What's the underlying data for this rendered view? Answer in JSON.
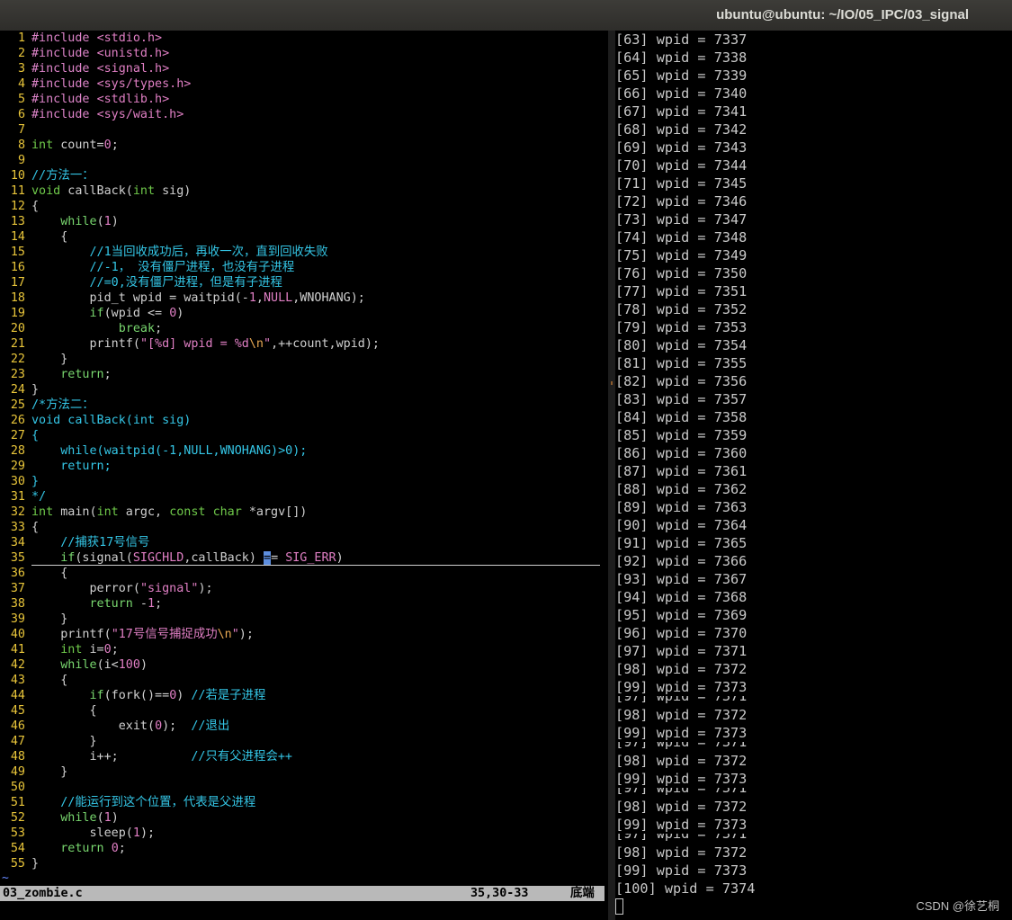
{
  "window": {
    "title": "ubuntu@ubuntu: ~/IO/05_IPC/03_signal"
  },
  "editor": {
    "filename": "03_zombie.c",
    "position": "35,30-33",
    "scroll_position": "底端",
    "tilde": "~",
    "lines": [
      {
        "n": "1",
        "segs": [
          {
            "c": "pp",
            "t": "#include "
          },
          {
            "c": "str",
            "t": "<stdio.h>"
          }
        ]
      },
      {
        "n": "2",
        "segs": [
          {
            "c": "pp",
            "t": "#include "
          },
          {
            "c": "str",
            "t": "<unistd.h>"
          }
        ]
      },
      {
        "n": "3",
        "segs": [
          {
            "c": "pp",
            "t": "#include "
          },
          {
            "c": "str",
            "t": "<signal.h>"
          }
        ]
      },
      {
        "n": "4",
        "segs": [
          {
            "c": "pp",
            "t": "#include "
          },
          {
            "c": "str",
            "t": "<sys/types.h>"
          }
        ]
      },
      {
        "n": "5",
        "segs": [
          {
            "c": "pp",
            "t": "#include "
          },
          {
            "c": "str",
            "t": "<stdlib.h>"
          }
        ]
      },
      {
        "n": "6",
        "segs": [
          {
            "c": "pp",
            "t": "#include "
          },
          {
            "c": "str",
            "t": "<sys/wait.h>"
          }
        ]
      },
      {
        "n": "7",
        "segs": []
      },
      {
        "n": "8",
        "segs": [
          {
            "c": "t",
            "t": "int"
          },
          {
            "c": "",
            "t": " count="
          },
          {
            "c": "num",
            "t": "0"
          },
          {
            "c": "",
            "t": ";"
          }
        ]
      },
      {
        "n": "9",
        "segs": []
      },
      {
        "n": "10",
        "segs": [
          {
            "c": "c",
            "t": "//方法一："
          }
        ]
      },
      {
        "n": "11",
        "segs": [
          {
            "c": "t",
            "t": "void"
          },
          {
            "c": "",
            "t": " callBack("
          },
          {
            "c": "t",
            "t": "int"
          },
          {
            "c": "",
            "t": " sig)"
          }
        ]
      },
      {
        "n": "12",
        "segs": [
          {
            "c": "",
            "t": "{"
          }
        ]
      },
      {
        "n": "13",
        "segs": [
          {
            "c": "",
            "t": "    "
          },
          {
            "c": "k",
            "t": "while"
          },
          {
            "c": "",
            "t": "("
          },
          {
            "c": "num",
            "t": "1"
          },
          {
            "c": "",
            "t": ")"
          }
        ]
      },
      {
        "n": "14",
        "segs": [
          {
            "c": "",
            "t": "    {"
          }
        ]
      },
      {
        "n": "15",
        "segs": [
          {
            "c": "",
            "t": "        "
          },
          {
            "c": "c",
            "t": "//1当回收成功后，再收一次，直到回收失败"
          }
        ]
      },
      {
        "n": "16",
        "segs": [
          {
            "c": "",
            "t": "        "
          },
          {
            "c": "c",
            "t": "//-1， 没有僵尸进程，也没有子进程"
          }
        ]
      },
      {
        "n": "17",
        "segs": [
          {
            "c": "",
            "t": "        "
          },
          {
            "c": "c",
            "t": "//=0,没有僵尸进程，但是有子进程"
          }
        ]
      },
      {
        "n": "18",
        "segs": [
          {
            "c": "",
            "t": "        pid_t wpid = waitpid(-"
          },
          {
            "c": "num",
            "t": "1"
          },
          {
            "c": "",
            "t": ","
          },
          {
            "c": "num",
            "t": "NULL"
          },
          {
            "c": "",
            "t": ",WNOHANG);"
          }
        ]
      },
      {
        "n": "19",
        "segs": [
          {
            "c": "",
            "t": "        "
          },
          {
            "c": "k",
            "t": "if"
          },
          {
            "c": "",
            "t": "(wpid <= "
          },
          {
            "c": "num",
            "t": "0"
          },
          {
            "c": "",
            "t": ")"
          }
        ]
      },
      {
        "n": "20",
        "segs": [
          {
            "c": "",
            "t": "            "
          },
          {
            "c": "k",
            "t": "break"
          },
          {
            "c": "",
            "t": ";"
          }
        ]
      },
      {
        "n": "21",
        "segs": [
          {
            "c": "",
            "t": "        printf("
          },
          {
            "c": "str",
            "t": "\"[%d] wpid = %d"
          },
          {
            "c": "esc",
            "t": "\\n"
          },
          {
            "c": "str",
            "t": "\""
          },
          {
            "c": "",
            "t": ",++count,wpid);"
          }
        ]
      },
      {
        "n": "22",
        "segs": [
          {
            "c": "",
            "t": "    }"
          }
        ]
      },
      {
        "n": "23",
        "segs": [
          {
            "c": "",
            "t": "    "
          },
          {
            "c": "k",
            "t": "return"
          },
          {
            "c": "",
            "t": ";"
          }
        ]
      },
      {
        "n": "24",
        "segs": [
          {
            "c": "",
            "t": "}"
          }
        ]
      },
      {
        "n": "25",
        "segs": [
          {
            "c": "c",
            "t": "/*方法二："
          }
        ]
      },
      {
        "n": "26",
        "segs": [
          {
            "c": "c",
            "t": "void callBack(int sig)"
          }
        ]
      },
      {
        "n": "27",
        "segs": [
          {
            "c": "c",
            "t": "{"
          }
        ]
      },
      {
        "n": "28",
        "segs": [
          {
            "c": "c",
            "t": "    while(waitpid(-1,NULL,WNOHANG)>0);"
          }
        ]
      },
      {
        "n": "29",
        "segs": [
          {
            "c": "c",
            "t": "    return;"
          }
        ]
      },
      {
        "n": "30",
        "segs": [
          {
            "c": "c",
            "t": "}"
          }
        ]
      },
      {
        "n": "31",
        "segs": [
          {
            "c": "c",
            "t": "*/"
          }
        ]
      },
      {
        "n": "32",
        "segs": [
          {
            "c": "t",
            "t": "int"
          },
          {
            "c": "",
            "t": " main("
          },
          {
            "c": "t",
            "t": "int"
          },
          {
            "c": "",
            "t": " argc, "
          },
          {
            "c": "t",
            "t": "const"
          },
          {
            "c": "",
            "t": " "
          },
          {
            "c": "t",
            "t": "char"
          },
          {
            "c": "",
            "t": " *argv[])"
          }
        ]
      },
      {
        "n": "33",
        "segs": [
          {
            "c": "",
            "t": "{"
          }
        ]
      },
      {
        "n": "34",
        "segs": [
          {
            "c": "",
            "t": "    "
          },
          {
            "c": "c",
            "t": "//捕获17号信号"
          }
        ]
      },
      {
        "n": "35",
        "segs": [
          {
            "c": "",
            "t": "    "
          },
          {
            "c": "k",
            "t": "if"
          },
          {
            "c": "",
            "t": "(signal("
          },
          {
            "c": "num",
            "t": "SIGCHLD"
          },
          {
            "c": "",
            "t": ",callBack) "
          },
          {
            "c": "cur",
            "t": "="
          },
          {
            "c": "",
            "t": "= "
          },
          {
            "c": "num",
            "t": "SIG_ERR"
          },
          {
            "c": "",
            "t": ")"
          }
        ]
      },
      {
        "n": "36",
        "segs": [
          {
            "c": "",
            "t": "    {"
          }
        ]
      },
      {
        "n": "37",
        "segs": [
          {
            "c": "",
            "t": "        perror("
          },
          {
            "c": "str",
            "t": "\"signal\""
          },
          {
            "c": "",
            "t": ");"
          }
        ]
      },
      {
        "n": "38",
        "segs": [
          {
            "c": "",
            "t": "        "
          },
          {
            "c": "k",
            "t": "return"
          },
          {
            "c": "",
            "t": " -"
          },
          {
            "c": "num",
            "t": "1"
          },
          {
            "c": "",
            "t": ";"
          }
        ]
      },
      {
        "n": "39",
        "segs": [
          {
            "c": "",
            "t": "    }"
          }
        ]
      },
      {
        "n": "40",
        "segs": [
          {
            "c": "",
            "t": "    printf("
          },
          {
            "c": "str",
            "t": "\"17号信号捕捉成功"
          },
          {
            "c": "esc",
            "t": "\\n"
          },
          {
            "c": "str",
            "t": "\""
          },
          {
            "c": "",
            "t": ");"
          }
        ]
      },
      {
        "n": "41",
        "segs": [
          {
            "c": "",
            "t": "    "
          },
          {
            "c": "t",
            "t": "int"
          },
          {
            "c": "",
            "t": " i="
          },
          {
            "c": "num",
            "t": "0"
          },
          {
            "c": "",
            "t": ";"
          }
        ]
      },
      {
        "n": "42",
        "segs": [
          {
            "c": "",
            "t": "    "
          },
          {
            "c": "k",
            "t": "while"
          },
          {
            "c": "",
            "t": "(i<"
          },
          {
            "c": "num",
            "t": "100"
          },
          {
            "c": "",
            "t": ")"
          }
        ]
      },
      {
        "n": "43",
        "segs": [
          {
            "c": "",
            "t": "    {"
          }
        ]
      },
      {
        "n": "44",
        "segs": [
          {
            "c": "",
            "t": "        "
          },
          {
            "c": "k",
            "t": "if"
          },
          {
            "c": "",
            "t": "(fork()=="
          },
          {
            "c": "num",
            "t": "0"
          },
          {
            "c": "",
            "t": ") "
          },
          {
            "c": "c",
            "t": "//若是子进程"
          }
        ]
      },
      {
        "n": "45",
        "segs": [
          {
            "c": "",
            "t": "        {"
          }
        ]
      },
      {
        "n": "46",
        "segs": [
          {
            "c": "",
            "t": "            exit("
          },
          {
            "c": "num",
            "t": "0"
          },
          {
            "c": "",
            "t": ");  "
          },
          {
            "c": "c",
            "t": "//退出"
          }
        ]
      },
      {
        "n": "47",
        "segs": [
          {
            "c": "",
            "t": "        }"
          }
        ]
      },
      {
        "n": "48",
        "segs": [
          {
            "c": "",
            "t": "        i++;          "
          },
          {
            "c": "c",
            "t": "//只有父进程会++"
          }
        ]
      },
      {
        "n": "49",
        "segs": [
          {
            "c": "",
            "t": "    }"
          }
        ]
      },
      {
        "n": "50",
        "segs": []
      },
      {
        "n": "51",
        "segs": [
          {
            "c": "",
            "t": "    "
          },
          {
            "c": "c",
            "t": "//能运行到这个位置，代表是父进程"
          }
        ]
      },
      {
        "n": "52",
        "segs": [
          {
            "c": "",
            "t": "    "
          },
          {
            "c": "k",
            "t": "while"
          },
          {
            "c": "",
            "t": "("
          },
          {
            "c": "num",
            "t": "1"
          },
          {
            "c": "",
            "t": ")"
          }
        ]
      },
      {
        "n": "53",
        "segs": [
          {
            "c": "",
            "t": "        sleep("
          },
          {
            "c": "num",
            "t": "1"
          },
          {
            "c": "",
            "t": ");"
          }
        ]
      },
      {
        "n": "54",
        "segs": [
          {
            "c": "",
            "t": "    "
          },
          {
            "c": "k",
            "t": "return"
          },
          {
            "c": "",
            "t": " "
          },
          {
            "c": "num",
            "t": "0"
          },
          {
            "c": "",
            "t": ";"
          }
        ]
      },
      {
        "n": "55",
        "segs": [
          {
            "c": "",
            "t": "}"
          }
        ]
      }
    ]
  },
  "terminal": {
    "lines": [
      "[63] wpid = 7337",
      "[64] wpid = 7338",
      "[65] wpid = 7339",
      "[66] wpid = 7340",
      "[67] wpid = 7341",
      "[68] wpid = 7342",
      "[69] wpid = 7343",
      "[70] wpid = 7344",
      "[71] wpid = 7345",
      "[72] wpid = 7346",
      "[73] wpid = 7347",
      "[74] wpid = 7348",
      "[75] wpid = 7349",
      "[76] wpid = 7350",
      "[77] wpid = 7351",
      "[78] wpid = 7352",
      "[79] wpid = 7353",
      "[80] wpid = 7354",
      "[81] wpid = 7355",
      "[82] wpid = 7356",
      "[83] wpid = 7357",
      "[84] wpid = 7358",
      "[85] wpid = 7359",
      "[86] wpid = 7360",
      "[87] wpid = 7361",
      "[88] wpid = 7362",
      "[89] wpid = 7363",
      "[90] wpid = 7364",
      "[91] wpid = 7365",
      "[92] wpid = 7366",
      "[93] wpid = 7367",
      "[94] wpid = 7368",
      "[95] wpid = 7369",
      "[96] wpid = 7370",
      "[97] wpid = 7371",
      "[98] wpid = 7372",
      "[99] wpid = 7373",
      "[97] wpid = 7371",
      "[98] wpid = 7372",
      "[99] wpid = 7373",
      "[97] wpid = 7371",
      "[98] wpid = 7372",
      "[99] wpid = 7373",
      "[97] wpid = 7371",
      "[98] wpid = 7372",
      "[99] wpid = 7373",
      "[97] wpid = 7371",
      "[98] wpid = 7372",
      "[99] wpid = 7373",
      "[100] wpid = 7374"
    ]
  },
  "watermark": "CSDN @徐艺桐"
}
